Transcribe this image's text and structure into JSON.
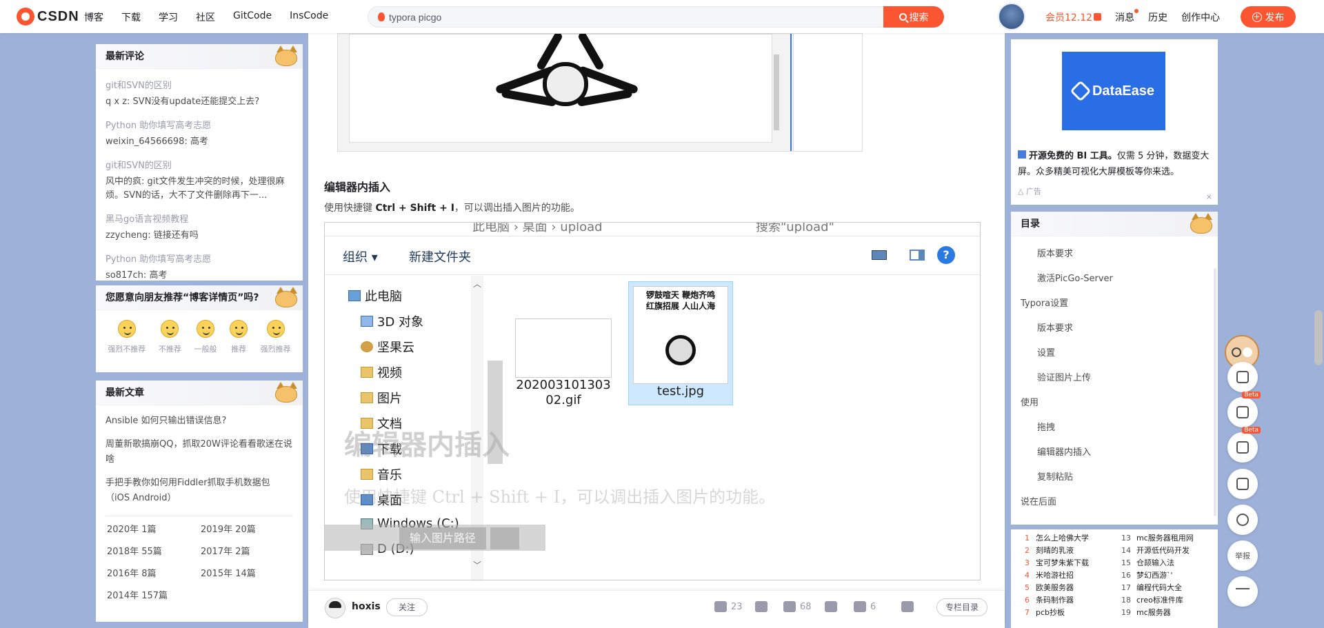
{
  "topbar": {
    "logo_text": "CSDN",
    "nav": [
      "博客",
      "下载",
      "学习",
      "社区",
      "GitCode",
      "InsCode"
    ],
    "search_value": "typora picgo",
    "search_button": "搜索",
    "vip": "会员12.12",
    "links": [
      "消息",
      "历史",
      "创作中心"
    ],
    "publish": "发布"
  },
  "comments": {
    "title": "最新评论",
    "items": [
      {
        "article": "git和SVN的区别",
        "text": "q x z: SVN没有update还能提交上去?"
      },
      {
        "article": "Python 助你填写高考志愿",
        "text": "weixin_64566698: 高考"
      },
      {
        "article": "git和SVN的区别",
        "text": "风中的疯: git文件发生冲突的时候，处理很麻烦。SVN的话，大不了文件删除再下一..."
      },
      {
        "article": "黑马go语言视频教程",
        "text": "zzycheng: 链接还有吗"
      },
      {
        "article": "Python 助你填写高考志愿",
        "text": "so817ch: 高考"
      }
    ]
  },
  "recommend": {
    "title": "您愿意向朋友推荐“博客详情页”吗?",
    "options": [
      "强烈不推荐",
      "不推荐",
      "一般般",
      "推荐",
      "强烈推荐"
    ]
  },
  "articles": {
    "title": "最新文章",
    "items": [
      "Ansible 如何只输出错误信息?",
      "周董新歌搞崩QQ，抓取20W评论看看歌迷在说啥",
      "手把手教你如何用Fiddler抓取手机数据包（iOS Android）"
    ],
    "archive": [
      "2020年  1篇",
      "2019年  20篇",
      "2018年  55篇",
      "2017年  2篇",
      "2016年  8篇",
      "2015年  14篇",
      "2014年  157篇"
    ]
  },
  "main": {
    "heading": "编辑器内插入",
    "para_before": "使用快捷键 ",
    "para_key": "Ctrl + Shift + I",
    "para_after": "，可以调出插入图片的功能。",
    "explorer": {
      "address": "此电脑  ›  桌面  ›  upload",
      "search_placeholder": "搜索\"upload\"",
      "organize": "组织 ▾",
      "new_folder": "新建文件夹",
      "help": "?",
      "tree": [
        "此电脑",
        "3D 对象",
        "坚果云",
        "视频",
        "图片",
        "文档",
        "下载",
        "音乐",
        "桌面",
        "Windows (C:)",
        "D (D:)"
      ],
      "files": [
        {
          "name": "20200310130302.gif"
        },
        {
          "name": "test.jpg",
          "caption": "锣鼓喧天 鞭炮齐鸣 红旗招展 人山人海"
        }
      ],
      "overlay_heading": "编辑器内插入",
      "overlay_para": "使用快捷键 Ctrl + Shift + I，可以调出插入图片的功能。",
      "overlay_input": "输入图片路径"
    }
  },
  "bottom": {
    "author": "hoxis",
    "follow": "关注",
    "likes": "23",
    "stars": "68",
    "comments": "6",
    "catalog": "专栏目录"
  },
  "ad": {
    "brand": "DataEase",
    "text_bold": "开源免费的 BI 工具。",
    "text": "仅需 5 分钟，数据变大屏。众多精美可视化大屏模板等你来选。",
    "label": "广告",
    "close": "×"
  },
  "toc": {
    "title": "目录",
    "items": [
      {
        "level": 2,
        "label": "版本要求"
      },
      {
        "level": 2,
        "label": "激活PicGo-Server"
      },
      {
        "level": 1,
        "label": "Typora设置"
      },
      {
        "level": 2,
        "label": "版本要求"
      },
      {
        "level": 2,
        "label": "设置"
      },
      {
        "level": 2,
        "label": "验证图片上传"
      },
      {
        "level": 1,
        "label": "使用"
      },
      {
        "level": 2,
        "label": "拖拽"
      },
      {
        "level": 2,
        "label": "编辑器内插入"
      },
      {
        "level": 2,
        "label": "复制粘贴"
      },
      {
        "level": 1,
        "label": "说在后面"
      }
    ]
  },
  "rank": [
    {
      "n": "1",
      "t": "怎么上哈佛大学"
    },
    {
      "n": "13",
      "t": "mc服务器租用网"
    },
    {
      "n": "2",
      "t": "刻晴的乳液"
    },
    {
      "n": "14",
      "t": "开源低代码开发"
    },
    {
      "n": "3",
      "t": "宝可梦朱紫下载"
    },
    {
      "n": "15",
      "t": "仓颉输入法"
    },
    {
      "n": "4",
      "t": "米哈游社招"
    },
    {
      "n": "16",
      "t": "梦幻西游`'"
    },
    {
      "n": "5",
      "t": "欧美服务器"
    },
    {
      "n": "17",
      "t": "编程代码大全"
    },
    {
      "n": "6",
      "t": "条码制作器"
    },
    {
      "n": "18",
      "t": "creo标准件库"
    },
    {
      "n": "7",
      "t": "pcb抄板"
    },
    {
      "n": "19",
      "t": "mc服务器"
    }
  ],
  "side": {
    "beta": "Beta",
    "report": "举报"
  },
  "colors": {
    "accent": "#fc5531",
    "page_bg": "#9eb1d9",
    "ad_blue": "#2a6ee6"
  }
}
